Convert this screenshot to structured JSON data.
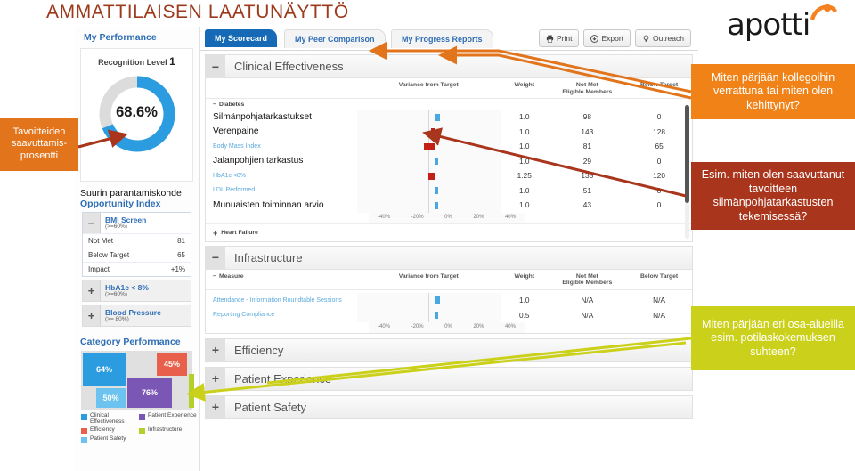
{
  "slide": {
    "title": "AMMATTILAISEN LAATUNÄYTTÖ",
    "title_color": "#9c3a1c"
  },
  "brand": {
    "name": "apotti",
    "dot_color": "#f58220"
  },
  "sidebar": {
    "title": "My Performance",
    "gauge": {
      "recognition_label": "Recognition Level",
      "recognition_level": "1",
      "value": "68.6%",
      "percent": 68.6,
      "arc_color": "#2b9ce0",
      "track_color": "#dcdcdc"
    },
    "opportunity": {
      "fi_label": "Suurin parantamiskohde",
      "en_label": "Opportunity Index",
      "items": [
        {
          "name": "BMI Screen",
          "sub": "(>=60%)",
          "toggle": "−",
          "expanded": true,
          "rows": [
            {
              "label": "Not Met",
              "value": "81"
            },
            {
              "label": "Below Target",
              "value": "65"
            },
            {
              "label": "Impact",
              "value": "+1%"
            }
          ]
        },
        {
          "name": "HbA1c < 8%",
          "sub": "(>=60%)",
          "toggle": "+",
          "expanded": false,
          "rows": []
        },
        {
          "name": "Blood Pressure",
          "sub": "(>= 80%)",
          "toggle": "+",
          "expanded": false,
          "rows": []
        }
      ]
    },
    "category_performance": {
      "title": "Category Performance",
      "tiles": [
        {
          "label": "64%",
          "color": "#2b9ce0"
        },
        {
          "label": "45%",
          "color": "#e8604c"
        },
        {
          "label": "76%",
          "color": "#7a57b5"
        },
        {
          "label": "50%",
          "color": "#6cc3ef"
        }
      ],
      "legend": [
        {
          "label": "Clinical Effectiveness",
          "color": "#2b9ce0"
        },
        {
          "label": "Patient Experience",
          "color": "#7a57b5"
        },
        {
          "label": "Efficiency",
          "color": "#e8604c"
        },
        {
          "label": "Infrastructure",
          "color": "#b4d028"
        },
        {
          "label": "Patient Safety",
          "color": "#6cc3ef"
        }
      ]
    }
  },
  "tabs": [
    {
      "label": "My Scorecard",
      "selected": true
    },
    {
      "label": "My Peer Comparison",
      "selected": false
    },
    {
      "label": "My Progress Reports",
      "selected": false
    }
  ],
  "toolbar": [
    {
      "label": "Print",
      "icon": "printer-icon"
    },
    {
      "label": "Export",
      "icon": "download-icon"
    },
    {
      "label": "Outreach",
      "icon": "lightbulb-icon"
    }
  ],
  "columns": {
    "measure": "Measure",
    "variance": "Variance from Target",
    "weight": "Weight",
    "not_met_line1": "Not Met",
    "not_met_line2": "Eligible Members",
    "below_target": "Below Target"
  },
  "axis_ticks": [
    "-40%",
    "-20%",
    "0%",
    "20%",
    "40%"
  ],
  "sections": [
    {
      "title": "Clinical Effectiveness",
      "toggle": "−",
      "expanded": true,
      "subgroup": {
        "label": "Diabetes",
        "toggle": "−"
      },
      "rows": [
        {
          "measure": "Silmänpohjatarkastukset",
          "finnish": true,
          "variance": 4,
          "weight": "1.0",
          "not_met": "98",
          "below_target": "0"
        },
        {
          "measure": "Verenpaine",
          "finnish": true,
          "variance": -3,
          "weight": "1.0",
          "not_met": "143",
          "below_target": "128"
        },
        {
          "measure": "Body Mass Index",
          "finnish": false,
          "variance": -8,
          "weight": "1.0",
          "not_met": "81",
          "below_target": "65"
        },
        {
          "measure": "Jalanpohjien tarkastus",
          "finnish": true,
          "variance": 1.5,
          "weight": "1.0",
          "not_met": "29",
          "below_target": "0"
        },
        {
          "measure": "HbA1c <8%",
          "finnish": false,
          "variance": -5,
          "weight": "1.25",
          "not_met": "135",
          "below_target": "120"
        },
        {
          "measure": "LDL Performed",
          "finnish": false,
          "variance": 1.5,
          "weight": "1.0",
          "not_met": "51",
          "below_target": "0"
        },
        {
          "measure": "Munuaisten toiminnan arvio",
          "finnish": true,
          "variance": 1.5,
          "weight": "1.0",
          "not_met": "43",
          "below_target": "0"
        }
      ],
      "footer": {
        "label": "Heart Failure",
        "toggle": "+"
      }
    },
    {
      "title": "Infrastructure",
      "toggle": "−",
      "expanded": true,
      "subgroup": null,
      "rows": [
        {
          "measure": "Attendance - Information Roundtable Sessions",
          "finnish": false,
          "variance": 4,
          "weight": "1.0",
          "not_met": "N/A",
          "below_target": "N/A"
        },
        {
          "measure": "Reporting Compliance",
          "finnish": false,
          "variance": 1.5,
          "weight": "0.5",
          "not_met": "N/A",
          "below_target": "N/A"
        }
      ],
      "footer": null
    }
  ],
  "collapsed_sections": [
    {
      "title": "Efficiency",
      "toggle": "+"
    },
    {
      "title": "Patient Experience",
      "toggle": "+"
    },
    {
      "title": "Patient Safety",
      "toggle": "+"
    }
  ],
  "callouts": {
    "left": {
      "text": "Tavoitteiden saavuttamis-prosentti",
      "color": "#e2741c"
    },
    "right1": {
      "text": "Miten pärjään kollegoihin verrattuna tai miten olen kehittynyt?",
      "color": "#f08218"
    },
    "right2": {
      "text": "Esim. miten olen saavuttanut tavoitteen silmänpohjatarkastusten tekemisessä?",
      "color": "#a8351c"
    },
    "right3": {
      "text": "Miten pärjään eri osa-alueilla esim. potilaskokemuksen suhteen?",
      "color": "#cbd11a"
    }
  }
}
